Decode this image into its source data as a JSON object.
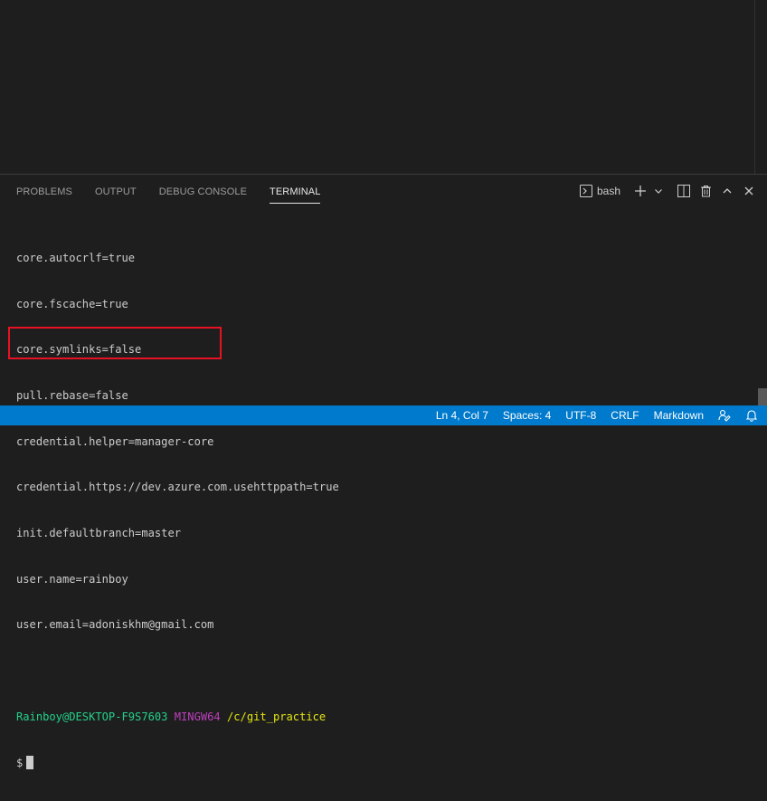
{
  "panel": {
    "tabs": [
      {
        "label": "PROBLEMS"
      },
      {
        "label": "OUTPUT"
      },
      {
        "label": "DEBUG CONSOLE"
      },
      {
        "label": "TERMINAL"
      }
    ],
    "active_tab": "TERMINAL",
    "shell_label": "bash"
  },
  "terminal": {
    "lines": [
      "core.autocrlf=true",
      "core.fscache=true",
      "core.symlinks=false",
      "pull.rebase=false",
      "credential.helper=manager-core",
      "credential.https://dev.azure.com.usehttppath=true",
      "init.defaultbranch=master",
      "user.name=rainboy",
      "user.email=adoniskhm@gmail.com",
      ""
    ],
    "prompt": {
      "user_host": "Rainboy@DESKTOP-F9S7603",
      "system": "MINGW64",
      "path": "/c/git_practice"
    },
    "input_symbol": "$"
  },
  "statusbar": {
    "position": "Ln 4, Col 7",
    "spaces": "Spaces: 4",
    "encoding": "UTF-8",
    "eol": "CRLF",
    "language": "Markdown"
  },
  "colors": {
    "statusbar_bg": "#007acc",
    "highlight_border": "#e81123",
    "prompt_user": "#23d18b",
    "prompt_system": "#bc3fbc",
    "prompt_path": "#e5e510"
  },
  "icons": [
    "terminal-icon",
    "plus-icon",
    "chevron-down-icon",
    "split-icon",
    "trash-icon",
    "chevron-up-icon",
    "close-icon",
    "feedback-icon",
    "bell-icon"
  ]
}
